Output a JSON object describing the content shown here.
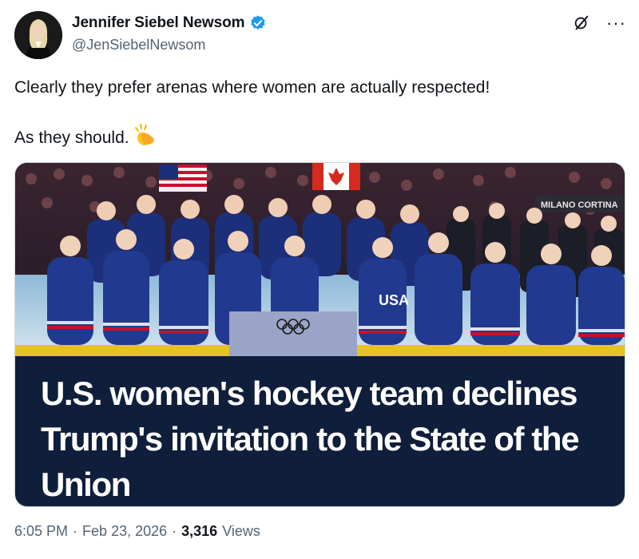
{
  "author": {
    "display_name": "Jennifer Siebel Newsom",
    "handle": "@JenSiebelNewsom",
    "verified": true
  },
  "icons": {
    "verified": "verified-badge-icon",
    "grok": "grok-icon",
    "more": "more-options-icon",
    "emoji": "clapping-hands-emoji"
  },
  "tweet": {
    "line1": "Clearly they prefer arenas where women are actually respected!",
    "line2": "As they should."
  },
  "card": {
    "headline": "U.S. women's hockey team declines Trump's invitation to the State of the Union",
    "image_banner": "MILANO CORTINA",
    "image_jersey": "USA"
  },
  "meta": {
    "time": "6:05 PM",
    "date": "Feb 23, 2026",
    "sep1": "·",
    "sep2": "·",
    "views_count": "3,316",
    "views_label": "Views"
  },
  "colors": {
    "accent": "#1d9bf0",
    "secondary_text": "#536471",
    "headline_bg": "#0f1e3a",
    "jersey": "#1c2f7a"
  }
}
